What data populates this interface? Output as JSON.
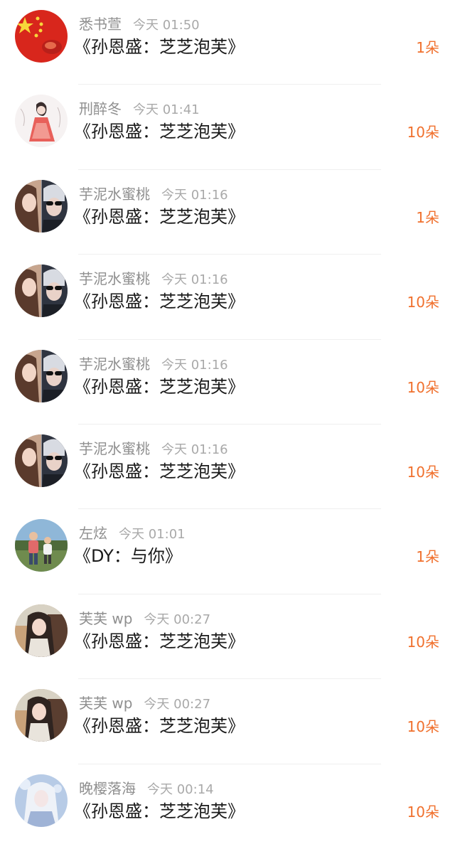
{
  "gift_list": [
    {
      "avatar": "flag-avatar",
      "name": "悉书萱",
      "time": "今天 01:50",
      "song": "《孙恩盛：芝芝泡芙》",
      "count": "1朵"
    },
    {
      "avatar": "sketch-girl-avatar",
      "name": "刑醉冬",
      "time": "今天 01:41",
      "song": "《孙恩盛：芝芝泡芙》",
      "count": "10朵"
    },
    {
      "avatar": "couple-avatar",
      "name": "芋泥水蜜桃",
      "time": "今天 01:16",
      "song": "《孙恩盛：芝芝泡芙》",
      "count": "1朵"
    },
    {
      "avatar": "couple-avatar",
      "name": "芋泥水蜜桃",
      "time": "今天 01:16",
      "song": "《孙恩盛：芝芝泡芙》",
      "count": "10朵"
    },
    {
      "avatar": "couple-avatar",
      "name": "芋泥水蜜桃",
      "time": "今天 01:16",
      "song": "《孙恩盛：芝芝泡芙》",
      "count": "10朵"
    },
    {
      "avatar": "couple-avatar",
      "name": "芋泥水蜜桃",
      "time": "今天 01:16",
      "song": "《孙恩盛：芝芝泡芙》",
      "count": "10朵"
    },
    {
      "avatar": "kids-photo-avatar",
      "name": "左炫",
      "time": "今天 01:01",
      "song": "《DY：与你》",
      "count": "1朵"
    },
    {
      "avatar": "girl-car-avatar",
      "name": "芙芙 wp",
      "time": "今天 00:27",
      "song": "《孙恩盛：芝芝泡芙》",
      "count": "10朵"
    },
    {
      "avatar": "girl-car-avatar",
      "name": "芙芙 wp",
      "time": "今天 00:27",
      "song": "《孙恩盛：芝芝泡芙》",
      "count": "10朵"
    },
    {
      "avatar": "anime-white-hair-avatar",
      "name": "晚樱落海",
      "time": "今天 00:14",
      "song": "《孙恩盛：芝芝泡芙》",
      "count": "10朵"
    }
  ],
  "colors": {
    "name": "#8f8f8f",
    "time": "#a9a9a9",
    "song": "#1a1a1a",
    "count": "#f0702d",
    "divider": "#efefef"
  }
}
